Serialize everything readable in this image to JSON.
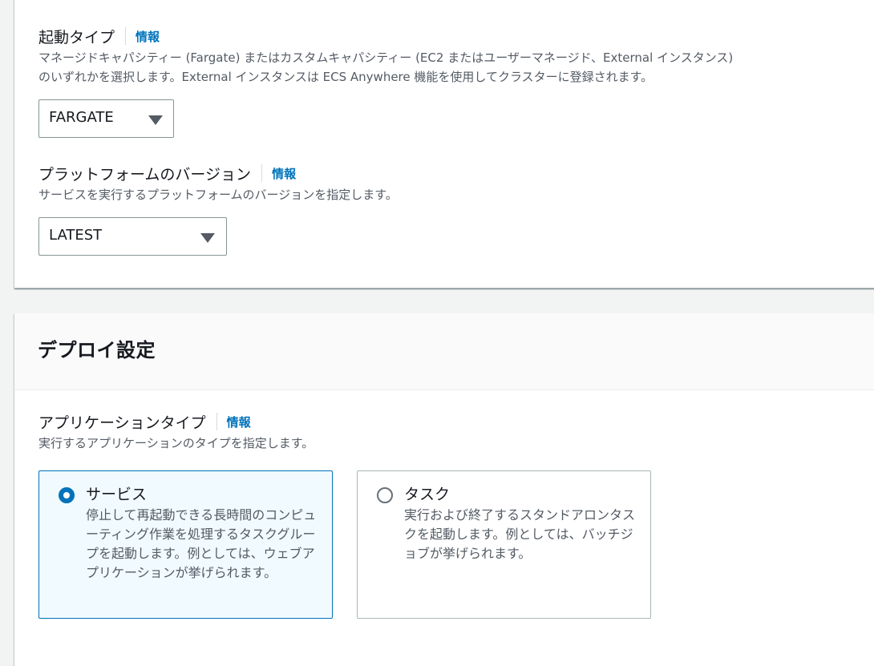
{
  "launch_type": {
    "label": "起動タイプ",
    "info": "情報",
    "description_line1": "マネージドキャパシティー (Fargate) またはカスタムキャパシティー (EC2 またはユーザーマネージド、External インスタンス)",
    "description_line2": "のいずれかを選択します。External インスタンスは ECS Anywhere 機能を使用してクラスターに登録されます。",
    "selected": "FARGATE"
  },
  "platform_version": {
    "label": "プラットフォームのバージョン",
    "info": "情報",
    "description": "サービスを実行するプラットフォームのバージョンを指定します。",
    "selected": "LATEST"
  },
  "deploy_section": {
    "title": "デプロイ設定"
  },
  "application_type": {
    "label": "アプリケーションタイプ",
    "info": "情報",
    "description": "実行するアプリケーションのタイプを指定します。",
    "options": [
      {
        "title": "サービス",
        "description": "停止して再起動できる長時間のコンピューティング作業を処理するタスクグループを起動します。例としては、ウェブアプリケーションが挙げられます。",
        "selected": true
      },
      {
        "title": "タスク",
        "description": "実行および終了するスタンドアロンタスクを起動します。例としては、バッチジョブが挙げられます。",
        "selected": false
      }
    ]
  },
  "colors": {
    "link": "#0073bb",
    "selected_tile_bg": "#f1faff",
    "text": "#16191f",
    "secondary_text": "#545b64"
  }
}
